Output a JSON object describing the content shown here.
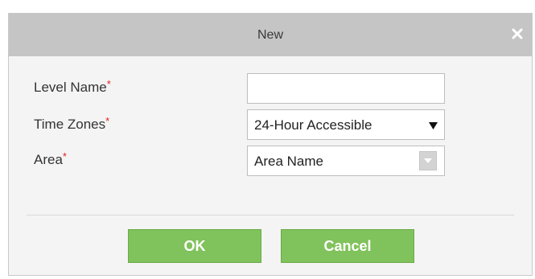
{
  "dialog": {
    "title": "New",
    "close_icon": "close-icon"
  },
  "form": {
    "required_marker": "*",
    "level_name": {
      "label": "Level Name",
      "value": ""
    },
    "time_zones": {
      "label": "Time Zones",
      "value": "24-Hour Accessible"
    },
    "area": {
      "label": "Area",
      "value": "Area Name"
    }
  },
  "buttons": {
    "ok_label": "OK",
    "cancel_label": "Cancel"
  },
  "colors": {
    "titlebar": "#c5c5c5",
    "button_green": "#80c25b",
    "required": "#e02020"
  }
}
